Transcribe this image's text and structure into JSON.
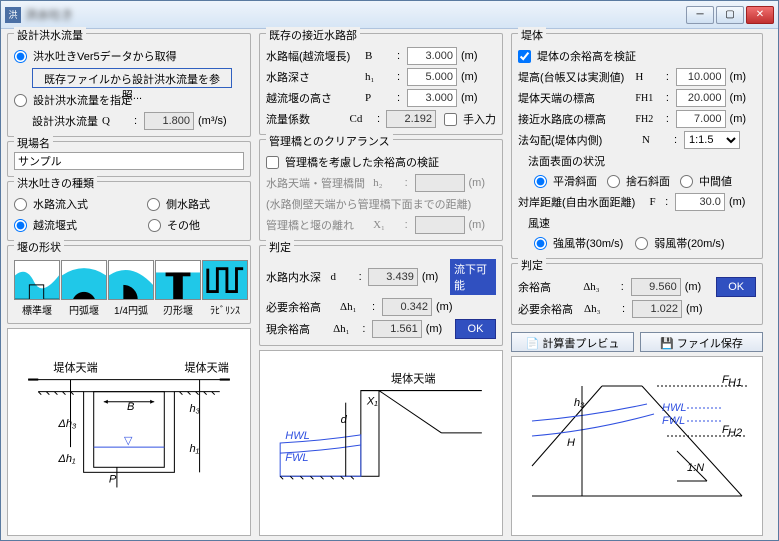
{
  "window": {
    "title": "洪水吐き"
  },
  "col1": {
    "designFlow": {
      "title": "設計洪水流量",
      "opt1": "洪水吐きVer5データから取得",
      "btnRef": "既存ファイルから設計洪水流量を参照...",
      "opt2": "設計洪水流量を指定",
      "qLabel": "設計洪水流量",
      "qSym": "Q",
      "qVal": "1.800",
      "qUnit": "(m³/s)"
    },
    "siteName": {
      "title": "現場名",
      "value": "サンプル"
    },
    "type": {
      "title": "洪水吐きの種類",
      "opt1": "水路流入式",
      "opt2": "側水路式",
      "opt3": "越流堰式",
      "opt4": "その他"
    },
    "shape": {
      "title": "堰の形状",
      "items": [
        "標準堰",
        "円弧堰",
        "1/4円弧",
        "刃形堰",
        "ﾗﾋﾞﾘﾝｽ"
      ]
    }
  },
  "col2": {
    "channel": {
      "title": "既存の接近水路部",
      "r1": {
        "label": "水路幅(越流堰長)",
        "sym": "B",
        "val": "3.000",
        "unit": "(m)"
      },
      "r2": {
        "label": "水路深さ",
        "sym": "h₁",
        "val": "5.000",
        "unit": "(m)"
      },
      "r3": {
        "label": "越流堰の高さ",
        "sym": "P",
        "val": "3.000",
        "unit": "(m)"
      },
      "r4": {
        "label": "流量係数",
        "sym": "Cd",
        "val": "2.192",
        "chk": "手入力"
      }
    },
    "clearance": {
      "title": "管理橋とのクリアランス",
      "chk": "管理橋を考慮した余裕高の検証",
      "r1": {
        "label": "水路天端・管理橋間",
        "sym": "h₂",
        "unit": "(m)"
      },
      "note": "(水路側壁天端から管理橋下面までの距離)",
      "r2": {
        "label": "管理橋と堰の離れ",
        "sym": "X₁",
        "unit": "(m)"
      }
    },
    "judge": {
      "title": "判定",
      "r1": {
        "label": "水路内水深",
        "sym": "d",
        "val": "3.439",
        "unit": "(m)",
        "badge": "流下可能"
      },
      "r2": {
        "label": "必要余裕高",
        "sym": "Δh₁",
        "val": "0.342",
        "unit": "(m)"
      },
      "r3": {
        "label": "現余裕高",
        "sym": "Δh₁",
        "val": "1.561",
        "unit": "(m)",
        "btn": "OK"
      }
    }
  },
  "col3": {
    "dam": {
      "title": "堤体",
      "chk": "堤体の余裕高を検証",
      "r1": {
        "label": "堤高(台帳又は実測値)",
        "sym": "H",
        "val": "10.000",
        "unit": "(m)"
      },
      "r2": {
        "label": "堤体天端の標高",
        "sym": "FH1",
        "val": "20.000",
        "unit": "(m)"
      },
      "r3": {
        "label": "接近水路底の標高",
        "sym": "FH2",
        "val": "7.000",
        "unit": "(m)"
      },
      "r4": {
        "label": "法勾配(堤体内側)",
        "sym": "N",
        "val": "1:1.5"
      },
      "surface": {
        "title": "法面表面の状況",
        "o1": "平滑斜面",
        "o2": "捨石斜面",
        "o3": "中間値"
      },
      "r5": {
        "label": "対岸距離(自由水面距離)",
        "sym": "F",
        "val": "30.0",
        "unit": "(m)"
      },
      "wind": {
        "title": "風速",
        "o1": "強風帯(30m/s)",
        "o2": "弱風帯(20m/s)"
      }
    },
    "judge": {
      "title": "判定",
      "r1": {
        "label": "余裕高",
        "sym": "Δh₃",
        "val": "9.560",
        "unit": "(m)",
        "btn": "OK"
      },
      "r2": {
        "label": "必要余裕高",
        "sym": "Δh₃",
        "val": "1.022",
        "unit": "(m)"
      }
    },
    "btns": {
      "preview": "計算書プレビュー...",
      "save": "ファイル保存"
    }
  },
  "diagram_labels": {
    "d1": "堤体天端",
    "d2": "堤体天端",
    "d3_hwl": "HWL",
    "d3_fwl": "FWL"
  }
}
